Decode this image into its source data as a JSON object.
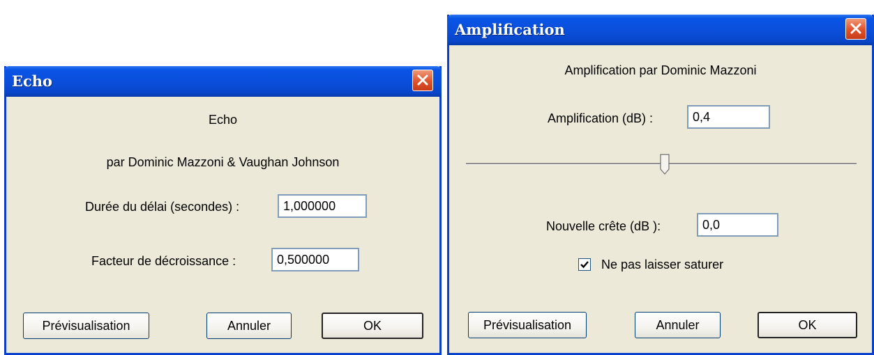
{
  "echo_dialog": {
    "title": "Echo",
    "heading": "Echo",
    "credit": "par Dominic Mazzoni & Vaughan Johnson",
    "delay_label": "Durée du délai (secondes) :",
    "delay_value": "1,000000",
    "decay_label": "Facteur de décroissance :",
    "decay_value": "0,500000",
    "preview_label": "Prévisualisation",
    "cancel_label": "Annuler",
    "ok_label": "OK"
  },
  "amplify_dialog": {
    "title": "Amplification",
    "credit": "Amplification par Dominic Mazzoni",
    "amplification_label": "Amplification (dB) :",
    "amplification_value": "0,4",
    "peak_label": "Nouvelle crête (dB ):",
    "peak_value": "0,0",
    "no_clip_label": "Ne pas laisser saturer",
    "no_clip_checked": true,
    "preview_label": "Prévisualisation",
    "cancel_label": "Annuler",
    "ok_label": "OK"
  }
}
